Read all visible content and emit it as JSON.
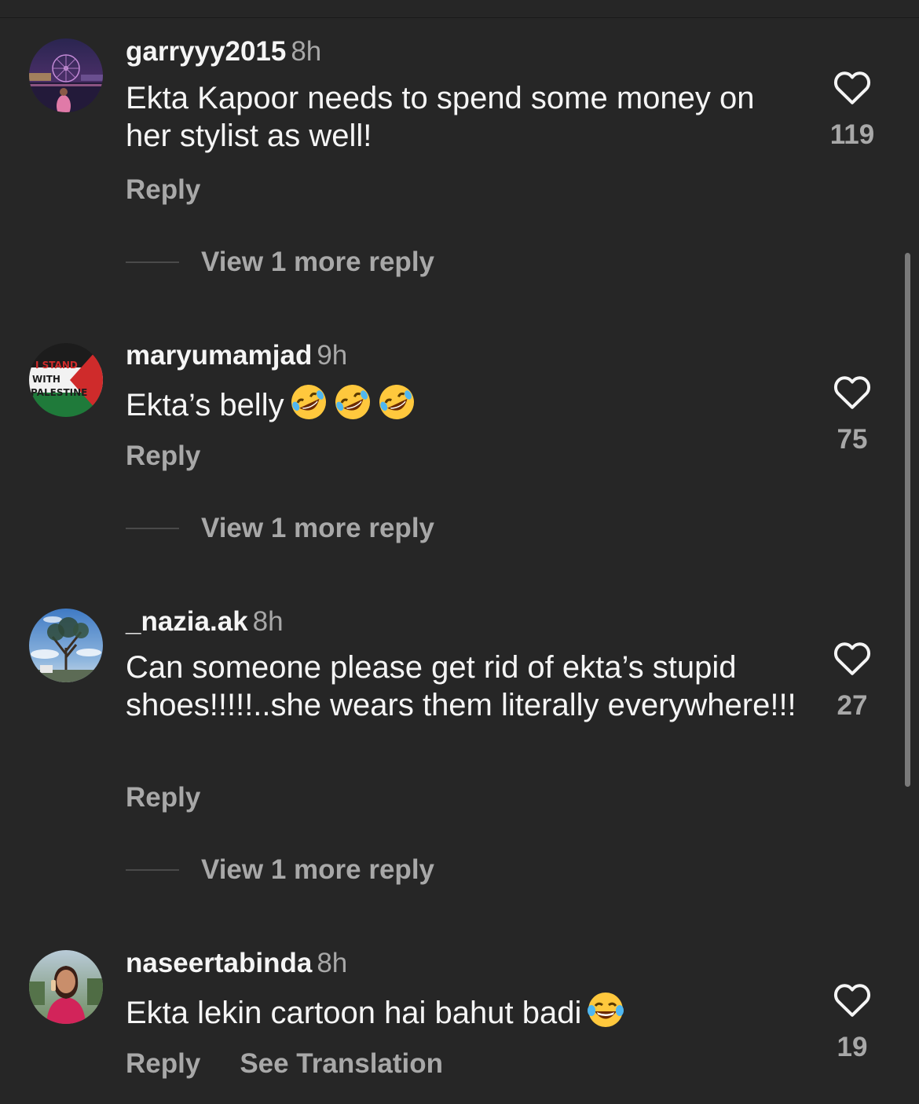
{
  "comments": [
    {
      "username": "garryyy2015",
      "time": "8h",
      "text": "Ekta Kapoor needs to spend some money on her stylist as well!",
      "likes": "119",
      "reply_label": "Reply",
      "view_more_label": "View 1 more reply",
      "avatar": "night-ferris-wheel-photo"
    },
    {
      "username": "maryumamjad",
      "time": "9h",
      "text": "Ekta’s belly",
      "emojis": [
        "rolling-on-floor-laughing-emoji",
        "rolling-on-floor-laughing-emoji",
        "rolling-on-floor-laughing-emoji"
      ],
      "likes": "75",
      "reply_label": "Reply",
      "view_more_label": "View 1 more reply",
      "avatar": "palestine-flag-badge",
      "avatar_text": [
        "I STAND",
        "WITH",
        "PALESTINE"
      ]
    },
    {
      "username": "_nazia.ak",
      "time": "8h",
      "text": "Can someone please get rid of ekta’s stupid shoes!!!!!..she wears them literally everywhere!!!",
      "likes": "27",
      "reply_label": "Reply",
      "view_more_label": "View 1 more reply",
      "avatar": "tree-sky-photo"
    },
    {
      "username": "naseertabinda",
      "time": "8h",
      "text": "Ekta lekin cartoon hai bahut badi",
      "emojis": [
        "face-with-tears-of-joy-emoji"
      ],
      "likes": "19",
      "reply_label": "Reply",
      "translate_label": "See Translation",
      "avatar": "person-portrait-photo"
    }
  ],
  "colors": {
    "background": "#262626",
    "primary_text": "#f5f5f5",
    "secondary_text": "#a8a8a8"
  },
  "icons": {
    "like": "heart-outline-icon"
  }
}
